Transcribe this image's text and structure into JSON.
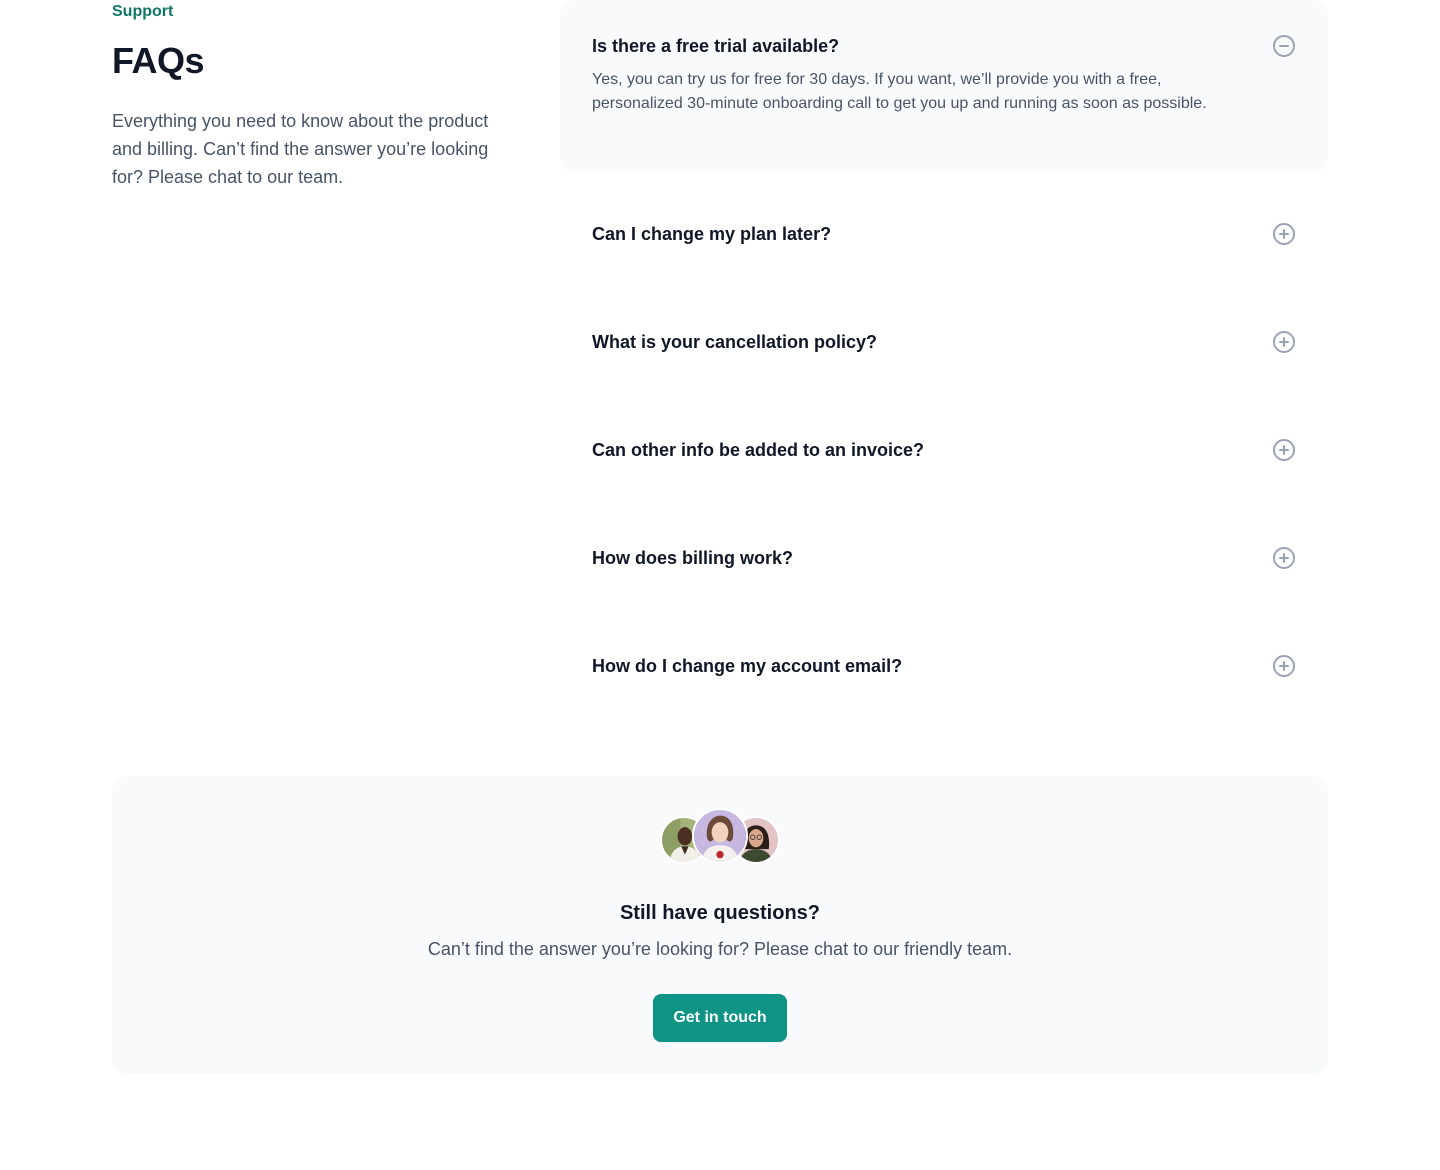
{
  "intro": {
    "eyebrow": "Support",
    "title": "FAQs",
    "description": "Everything you need to know about the product and billing. Can’t find the answer you’re looking for? Please chat to our team."
  },
  "faqs": [
    {
      "question": "Is there a free trial available?",
      "answer": "Yes, you can try us for free for 30 days. If you want, we’ll provide you with a free, personalized 30-minute onboarding call to get you up and running as soon as possible.",
      "open": true,
      "icon": "minus-circle-icon"
    },
    {
      "question": "Can I change my plan later?",
      "open": false,
      "icon": "plus-circle-icon"
    },
    {
      "question": "What is your cancellation policy?",
      "open": false,
      "icon": "plus-circle-icon"
    },
    {
      "question": "Can other info be added to an invoice?",
      "open": false,
      "icon": "plus-circle-icon"
    },
    {
      "question": "How does billing work?",
      "open": false,
      "icon": "plus-circle-icon"
    },
    {
      "question": "How do I change my account email?",
      "open": false,
      "icon": "plus-circle-icon"
    }
  ],
  "cta": {
    "title": "Still have questions?",
    "description": "Can’t find the answer you’re looking for? Please chat to our friendly team.",
    "button_label": "Get in touch"
  },
  "colors": {
    "accent": "#0e9384",
    "eyebrow": "#107569",
    "heading": "#101828",
    "body_text": "#475467",
    "card_bg": "#f9fafb",
    "icon_stroke": "#98a2b3"
  }
}
